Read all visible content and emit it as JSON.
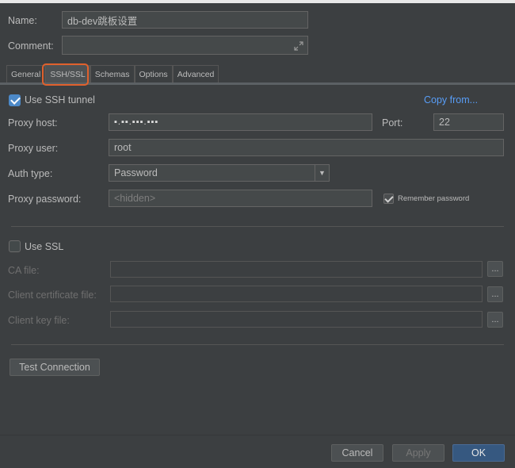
{
  "form": {
    "name_label": "Name:",
    "name_value": "db-dev跳板设置",
    "comment_label": "Comment:",
    "comment_value": "",
    "expand_icon": "expand-arrows-icon"
  },
  "tabs": [
    {
      "label": "General",
      "active": false
    },
    {
      "label": "SSH/SSL",
      "active": true
    },
    {
      "label": "Schemas",
      "active": false
    },
    {
      "label": "Options",
      "active": false
    },
    {
      "label": "Advanced",
      "active": false
    }
  ],
  "ssh": {
    "use_tunnel_label": "Use SSH tunnel",
    "use_tunnel_checked": true,
    "copy_from_label": "Copy from...",
    "proxy_host_label": "Proxy host:",
    "proxy_host_value": "▪.▪▪.▪▪▪.▪▪▪",
    "port_label": "Port:",
    "port_value": "22",
    "proxy_user_label": "Proxy user:",
    "proxy_user_value": "root",
    "auth_type_label": "Auth type:",
    "auth_type_value": "Password",
    "proxy_password_label": "Proxy password:",
    "proxy_password_placeholder": "<hidden>",
    "remember_password_label": "Remember password",
    "remember_password_checked": true
  },
  "ssl": {
    "use_ssl_label": "Use SSL",
    "use_ssl_checked": false,
    "ca_file_label": "CA file:",
    "client_cert_label": "Client certificate file:",
    "client_key_label": "Client key file:",
    "browse_label": "..."
  },
  "buttons": {
    "test_connection": "Test Connection",
    "cancel": "Cancel",
    "apply": "Apply",
    "ok": "OK"
  },
  "colors": {
    "background": "#3c3f41",
    "accent": "#4c89c8",
    "link": "#589df6",
    "highlight_box": "#e0612d",
    "primary_button": "#365880"
  }
}
